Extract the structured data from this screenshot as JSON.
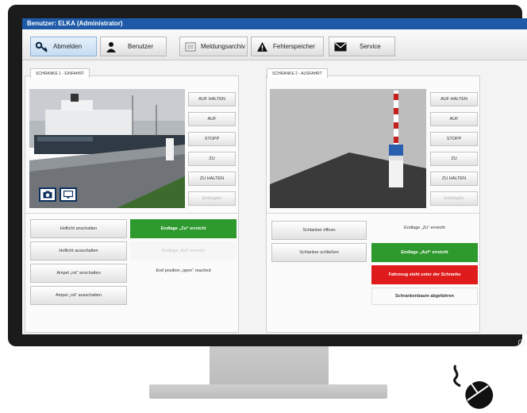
{
  "window": {
    "title": "Benutzer: ELKA (Administrator)"
  },
  "nav": {
    "items": [
      {
        "label": "Abmelden",
        "icon": "key-icon",
        "active": true
      },
      {
        "label": "Benutzer",
        "icon": "user-icon",
        "active": false
      },
      {
        "label": "Meldungsarchiv",
        "icon": "archive-icon",
        "active": false
      },
      {
        "label": "Fehlerspeicher",
        "icon": "warning-icon",
        "active": false
      },
      {
        "label": "Service",
        "icon": "mail-icon",
        "active": false
      }
    ]
  },
  "left": {
    "tab": "SCHRANKE 1 - EINFAHRT",
    "camera_icons": [
      "camera-icon",
      "monitor-icon"
    ],
    "controls": [
      "AUF HALTEN",
      "AUF",
      "STOPP",
      "ZU",
      "ZU HALTEN",
      "Entriegeln"
    ],
    "actions": [
      "Hoflicht anschalten",
      "Hoflicht ausschalten",
      "Ampel „rot“ anschalten",
      "Ampel „rot“ ausschalten"
    ],
    "statuses": [
      "Endlage „Zu“ erreicht",
      "Endlage „Auf“ erreicht",
      "End position „open“ reached"
    ]
  },
  "right": {
    "tab": "SCHRANKE 2 - AUSFAHRT",
    "controls": [
      "AUF HALTEN",
      "AUF",
      "STOPP",
      "ZU",
      "ZU HALTEN",
      "Entriegeln"
    ],
    "actions": [
      "Schlanker öffnen",
      "Schlanker schließen"
    ],
    "statuses": [
      "Endlage „Zu“ erreicht",
      "Endlage „Auf“ erreicht",
      "Fahrzeug steht unter der Schranke",
      "Schrankenbaum abgefahren"
    ]
  },
  "colors": {
    "accent": "#1e5aa8",
    "status_green": "#2e9a2e",
    "status_red": "#e01b1b"
  }
}
